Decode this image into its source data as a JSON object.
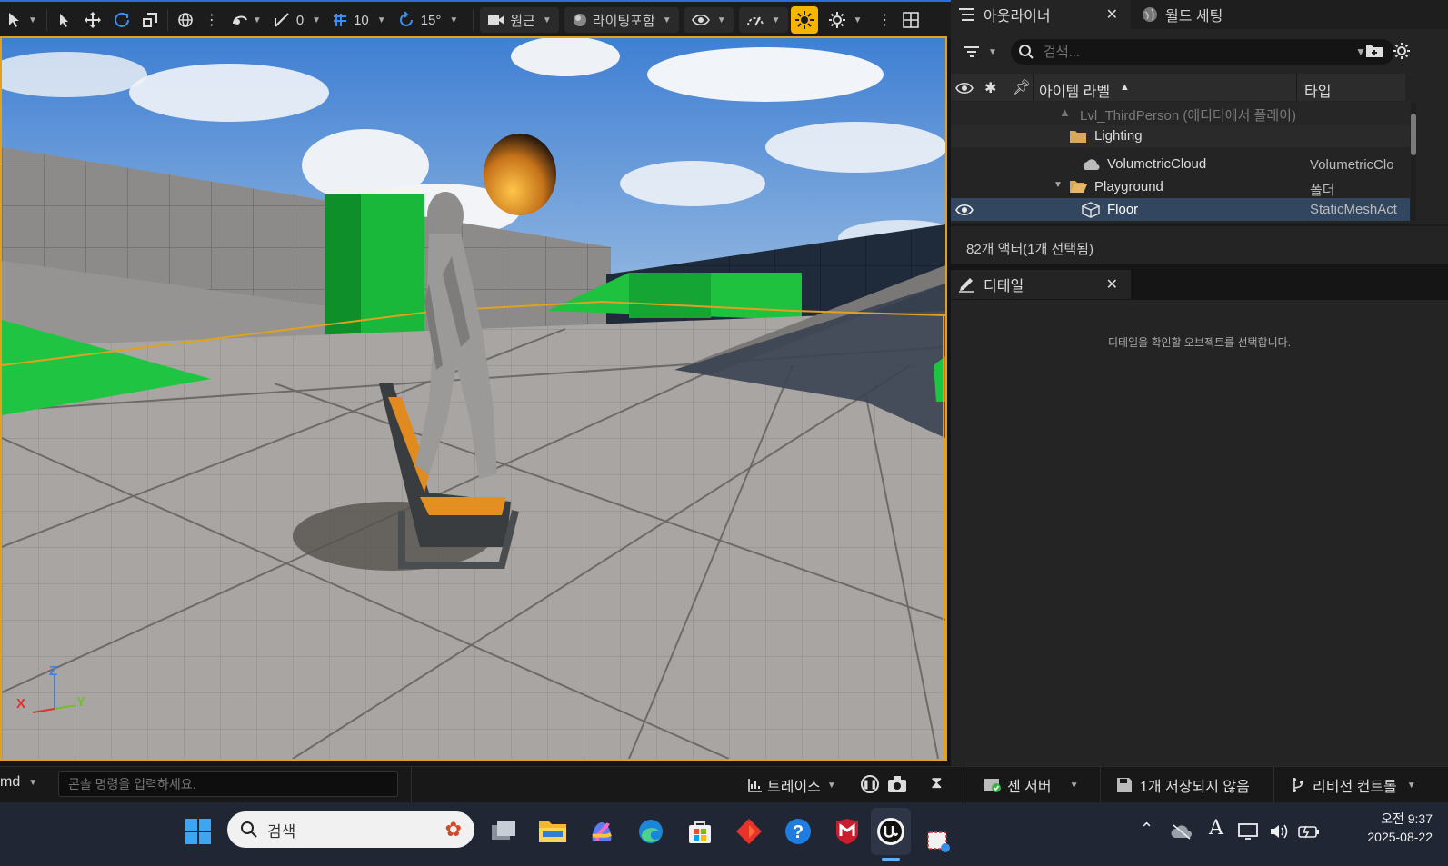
{
  "toolbar": {
    "snap_angle": "0",
    "grid_size": "10",
    "rotation_snap": "15°",
    "perspective_label": "원근",
    "lit_label": "라이팅포함"
  },
  "outliner": {
    "tab_title": "아웃라이너",
    "world_settings_tab": "월드 세팅",
    "search_placeholder": "검색...",
    "col_item_label": "아이템 라벨",
    "col_type": "타입",
    "rows": [
      {
        "label": "Lvl_ThirdPerson (에디터에서 플레이)",
        "type": ""
      },
      {
        "label": "Lighting",
        "type": ""
      },
      {
        "label": "VolumetricCloud",
        "type": "VolumetricClo"
      },
      {
        "label": "Playground",
        "type": "폴더"
      },
      {
        "label": "Floor",
        "type": "StaticMeshAct"
      }
    ],
    "actor_count": "82개 액터(1개 선택됨)"
  },
  "details": {
    "tab_title": "디테일",
    "empty_message": "디테일을 확인할 오브젝트를 선택합니다."
  },
  "viewport": {
    "axis_x": "X",
    "axis_y": "Y",
    "axis_z": "Z"
  },
  "status": {
    "cmd_label": "md",
    "console_placeholder": "콘솔 명령을 입력하세요.",
    "trace_label": "트레이스",
    "zen_label": "젠 서버",
    "unsaved_label": "1개 저장되지 않음",
    "revision_label": "리비전 컨트롤"
  },
  "taskbar": {
    "search_label": "검색",
    "time": "오전 9:37",
    "date": "2025-08-22"
  },
  "colors": {
    "accent": "#f5b400",
    "selection": "#2d3e55",
    "viewport_border": "#e0a020"
  }
}
